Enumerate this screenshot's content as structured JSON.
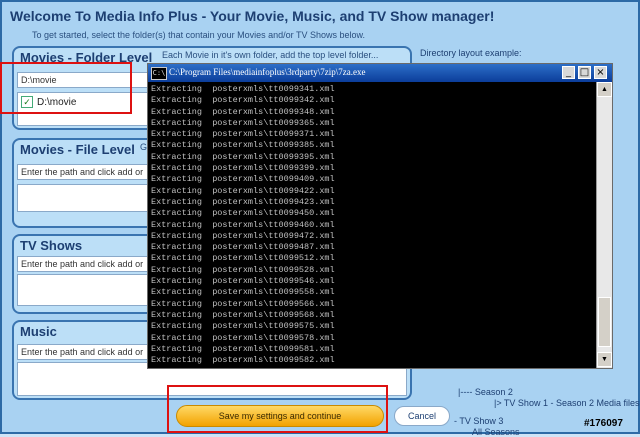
{
  "app": {
    "title": "Welcome To Media Info Plus - Your Movie, Music, and TV Show manager!",
    "subtitle": "To get started, select the folder(s) that contain your Movies and/or TV Shows below."
  },
  "movies_folder": {
    "title": "Movies - Folder Level",
    "hint": "Each Movie in it's own folder, add the top level folder...",
    "input_value": "D:\\movie",
    "items": [
      {
        "label": "D:\\movie",
        "checked": true
      }
    ]
  },
  "movies_file": {
    "title": "Movies - File Level",
    "hint": "G",
    "input_value": "Enter the path and click add or"
  },
  "tv_shows": {
    "title": "TV Shows",
    "input_value": "Enter the path and click add or"
  },
  "music": {
    "title": "Music",
    "input_value": "Enter the path and click add or"
  },
  "right_panel": {
    "label": "Directory layout example:",
    "tree": [
      "|---- Season 2",
      "|> TV Show 1 - Season 2 Media files",
      "- TV Show 3",
      "All Seasons"
    ]
  },
  "console": {
    "title": "C:\\Program Files\\mediainfoplus\\3rdparty\\7zip\\7za.exe",
    "icon_text": "C:\\",
    "lines": [
      "Extracting  posterxmls\\tt0099341.xml",
      "Extracting  posterxmls\\tt0099342.xml",
      "Extracting  posterxmls\\tt0099348.xml",
      "Extracting  posterxmls\\tt0099365.xml",
      "Extracting  posterxmls\\tt0099371.xml",
      "Extracting  posterxmls\\tt0099385.xml",
      "Extracting  posterxmls\\tt0099395.xml",
      "Extracting  posterxmls\\tt0099399.xml",
      "Extracting  posterxmls\\tt0099409.xml",
      "Extracting  posterxmls\\tt0099422.xml",
      "Extracting  posterxmls\\tt0099423.xml",
      "Extracting  posterxmls\\tt0099450.xml",
      "Extracting  posterxmls\\tt0099460.xml",
      "Extracting  posterxmls\\tt0099472.xml",
      "Extracting  posterxmls\\tt0099487.xml",
      "Extracting  posterxmls\\tt0099512.xml",
      "Extracting  posterxmls\\tt0099528.xml",
      "Extracting  posterxmls\\tt0099546.xml",
      "Extracting  posterxmls\\tt0099558.xml",
      "Extracting  posterxmls\\tt0099566.xml",
      "Extracting  posterxmls\\tt0099568.xml",
      "Extracting  posterxmls\\tt0099575.xml",
      "Extracting  posterxmls\\tt0099578.xml",
      "Extracting  posterxmls\\tt0099581.xml",
      "Extracting  posterxmls\\tt0099582.xml"
    ],
    "buttons": {
      "minimize": "_",
      "maximize": "□",
      "close": "×"
    }
  },
  "actions": {
    "save_label": "Save my settings and continue",
    "cancel_label": "Cancel"
  },
  "watermark": "#176097",
  "colors": {
    "accent": "#f2a200",
    "highlight": "#dd1111",
    "console_bg": "#000000"
  }
}
